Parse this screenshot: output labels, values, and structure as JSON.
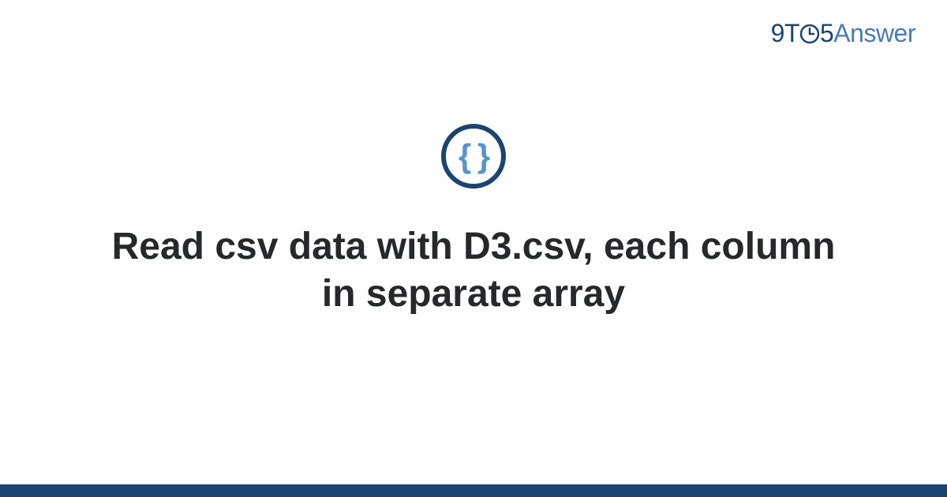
{
  "logo": {
    "nine": "9",
    "t": "T",
    "five": "5",
    "answer": "Answer"
  },
  "icon": {
    "name": "json-braces-icon",
    "glyph": "{ }"
  },
  "title": "Read csv data with D3.csv, each column in separate array",
  "colors": {
    "brand_dark": "#1a4570",
    "brand_light": "#4a7bb5",
    "icon_blue": "#5894cc",
    "text_dark": "#26292c"
  }
}
